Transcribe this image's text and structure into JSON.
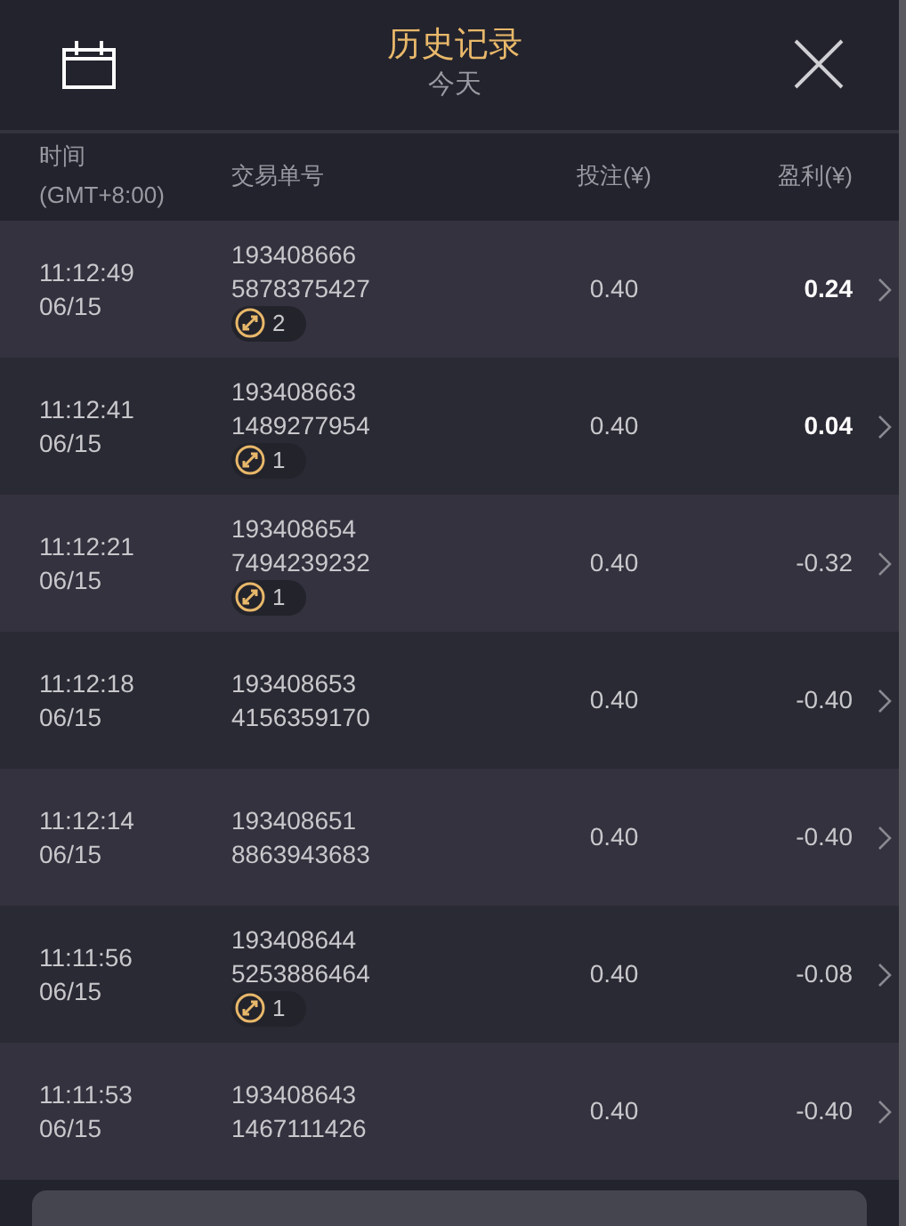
{
  "header": {
    "title": "历史记录",
    "subtitle": "今天"
  },
  "columns": [
    {
      "label": "时间",
      "sub": "(GMT+8:00)"
    },
    {
      "label": "交易单号"
    },
    {
      "label": "投注(¥)"
    },
    {
      "label": "盈利(¥)"
    }
  ],
  "rows": [
    {
      "time": "11:12:49",
      "date": "06/15",
      "order_1": "193408666",
      "order_2": "5878375427",
      "badge": "2",
      "stake": "0.40",
      "profit": "0.24",
      "positive": true
    },
    {
      "time": "11:12:41",
      "date": "06/15",
      "order_1": "193408663",
      "order_2": "1489277954",
      "badge": "1",
      "stake": "0.40",
      "profit": "0.04",
      "positive": true
    },
    {
      "time": "11:12:21",
      "date": "06/15",
      "order_1": "193408654",
      "order_2": "7494239232",
      "badge": "1",
      "stake": "0.40",
      "profit": "-0.32",
      "positive": false
    },
    {
      "time": "11:12:18",
      "date": "06/15",
      "order_1": "193408653",
      "order_2": "4156359170",
      "stake": "0.40",
      "profit": "-0.40",
      "positive": false
    },
    {
      "time": "11:12:14",
      "date": "06/15",
      "order_1": "193408651",
      "order_2": "8863943683",
      "stake": "0.40",
      "profit": "-0.40",
      "positive": false
    },
    {
      "time": "11:11:56",
      "date": "06/15",
      "order_1": "193408644",
      "order_2": "5253886464",
      "badge": "1",
      "stake": "0.40",
      "profit": "-0.08",
      "positive": false
    },
    {
      "time": "11:11:53",
      "date": "06/15",
      "order_1": "193408643",
      "order_2": "1467111426",
      "stake": "0.40",
      "profit": "-0.40",
      "positive": false
    }
  ]
}
